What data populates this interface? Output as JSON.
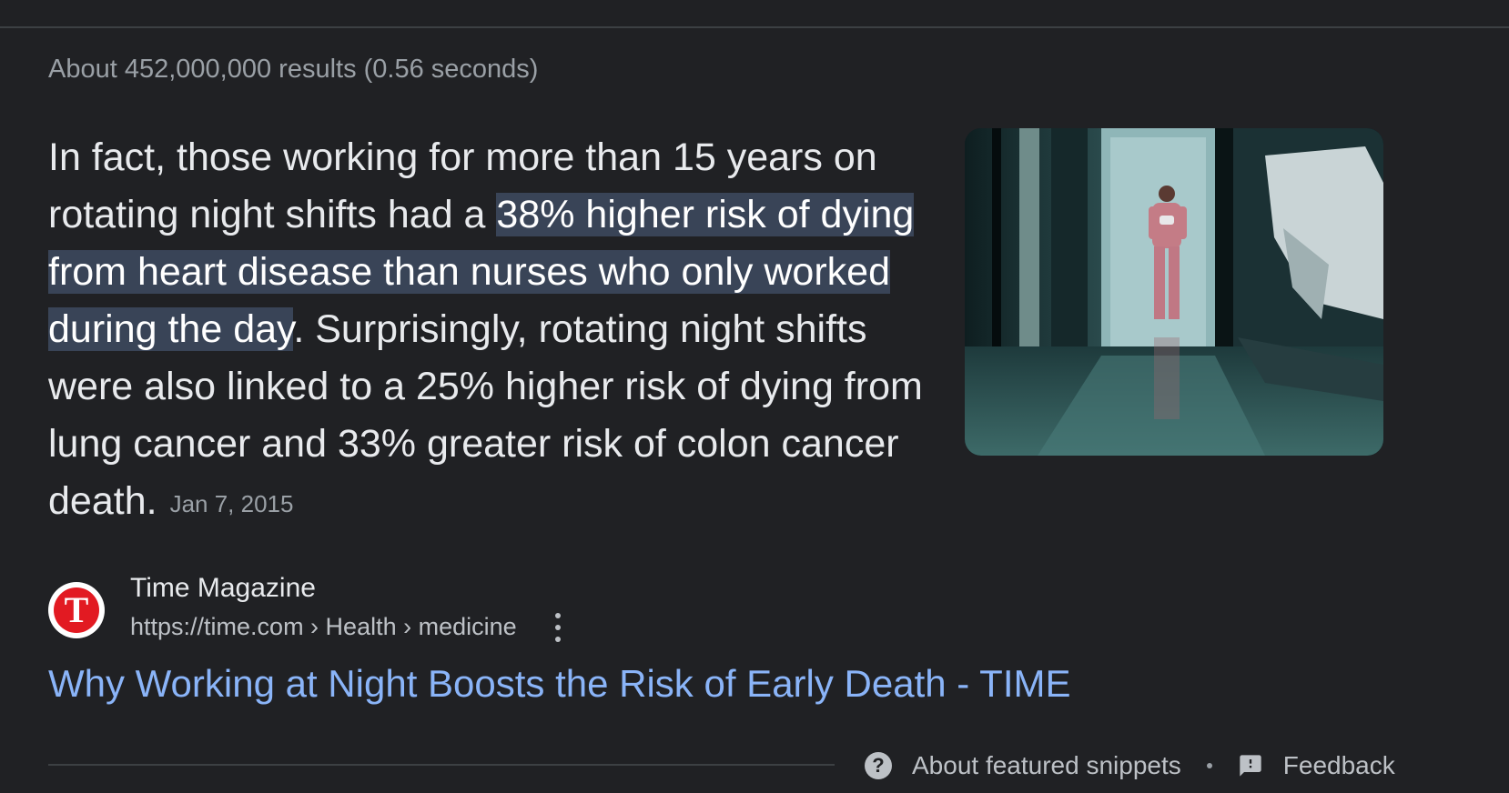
{
  "results": {
    "stats": "About 452,000,000 results (0.56 seconds)"
  },
  "snippet": {
    "text_before": "In fact, those working for more than 15 years on rotating night shifts had a ",
    "highlight": "38% higher risk of dying from heart disease than nurses who only worked during the day",
    "text_after": ". Surprisingly, rotating night shifts were also linked to a 25% higher risk of dying from lung cancer and 33% greater risk of colon cancer death.",
    "date": "Jan 7, 2015"
  },
  "image": {
    "icon": "nurse-hospital-corridor-image"
  },
  "source": {
    "favicon_letter": "T",
    "name": "Time Magazine",
    "url": "https://time.com › Health › medicine",
    "menu_icon": "more-vert-icon"
  },
  "result": {
    "title": "Why Working at Night Boosts the Risk of Early Death - TIME"
  },
  "footer": {
    "about_label": "About featured snippets",
    "about_icon": "help-circle-icon",
    "feedback_label": "Feedback",
    "feedback_icon": "feedback-icon"
  },
  "colors": {
    "background": "#202124",
    "highlight_bg": "#394457",
    "link": "#8ab4f8",
    "secondary_text": "#9aa0a6"
  }
}
